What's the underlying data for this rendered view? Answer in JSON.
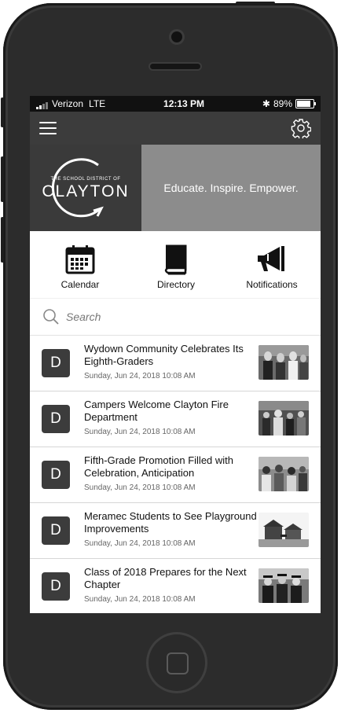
{
  "status_bar": {
    "carrier": "Verizon",
    "network": "LTE",
    "time": "12:13 PM",
    "battery": "89%",
    "battery_level": 0.89
  },
  "icons": {
    "menu": "hamburger-icon",
    "settings": "gear-icon",
    "search": "search-icon"
  },
  "banner": {
    "logo_top": "THE SCHOOL DISTRICT OF",
    "logo_main": "CLAYTON",
    "tagline": "Educate. Inspire. Empower."
  },
  "quick_links": [
    {
      "label": "Calendar",
      "icon": "calendar-icon"
    },
    {
      "label": "Directory",
      "icon": "book-icon"
    },
    {
      "label": "Notifications",
      "icon": "megaphone-icon"
    }
  ],
  "search": {
    "placeholder": "Search"
  },
  "news": [
    {
      "avatar": "D",
      "title": "Wydown Community Celebrates Its Eighth-Graders",
      "date": "Sunday, Jun 24, 2018 10:08 AM"
    },
    {
      "avatar": "D",
      "title": "Campers Welcome Clayton Fire Department",
      "date": "Sunday, Jun 24, 2018 10:08 AM"
    },
    {
      "avatar": "D",
      "title": "Fifth-Grade Promotion Filled with Celebration, Anticipation",
      "date": "Sunday, Jun 24, 2018 10:08 AM"
    },
    {
      "avatar": "D",
      "title": "Meramec Students to See Playground Improvements",
      "date": "Sunday, Jun 24, 2018 10:08 AM"
    },
    {
      "avatar": "D",
      "title": "Class of 2018 Prepares for the Next Chapter",
      "date": "Sunday, Jun 24, 2018 10:08 AM"
    }
  ],
  "colors": {
    "navbar": "#3c3c3c",
    "banner_right": "#8c8c8c",
    "avatar": "#3c3c3c"
  }
}
